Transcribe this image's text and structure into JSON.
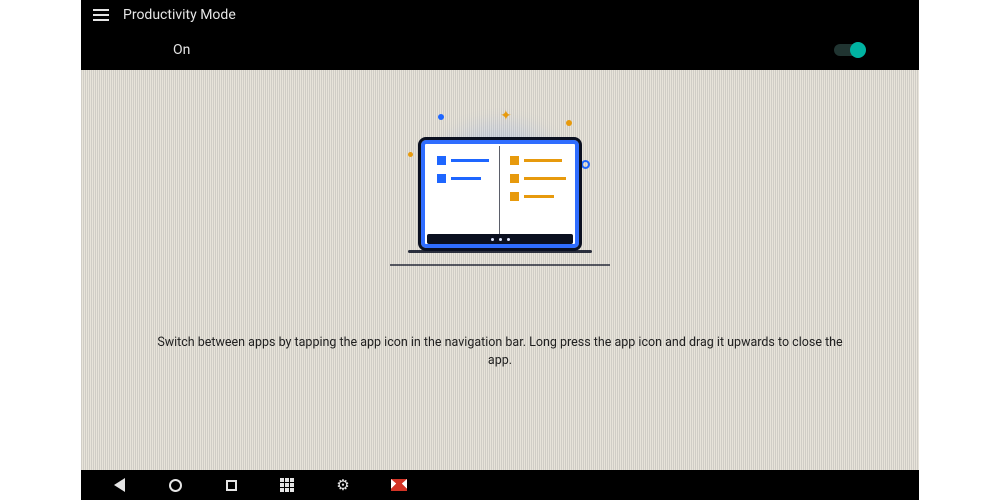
{
  "header": {
    "title": "Productivity Mode"
  },
  "toggle": {
    "label": "On",
    "state": "on"
  },
  "instruction_text": "Switch between apps by tapping the app icon in the navigation bar. Long press the app icon and drag it upwards to close the app.",
  "nav": {
    "back": "back-icon",
    "home": "home-icon",
    "recent": "recent-icon",
    "apps": "app-drawer-icon",
    "settings": "settings-icon",
    "gmail": "gmail-icon"
  },
  "colors": {
    "accent": "#00b3a1",
    "illus_blue": "#1e66ff",
    "illus_amber": "#e79a0d"
  }
}
